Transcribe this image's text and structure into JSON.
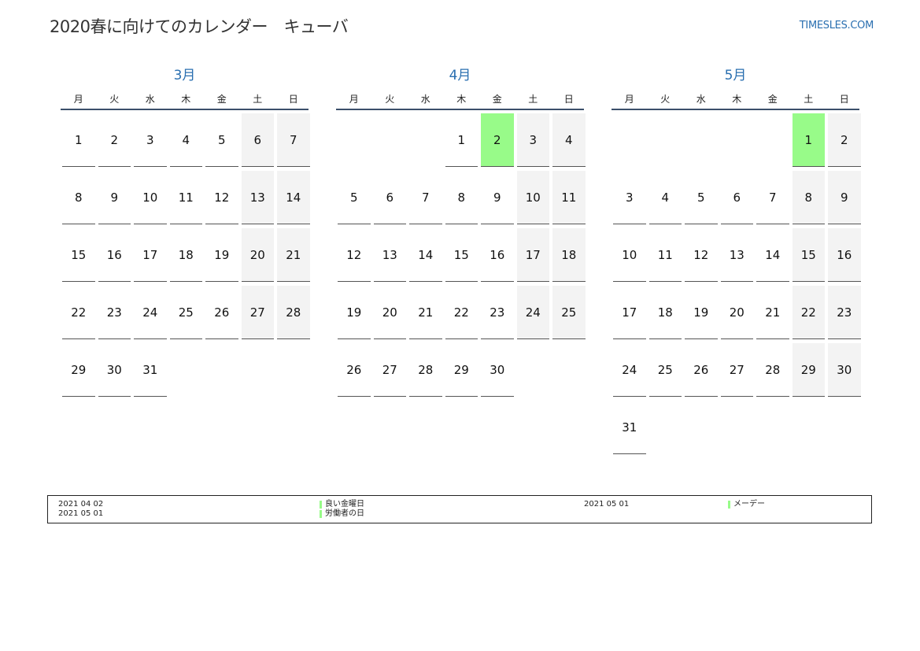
{
  "header": {
    "title": "2020春に向けてのカレンダー　キューバ",
    "site": "TIMESLES.COM"
  },
  "weekdays": [
    "月",
    "火",
    "水",
    "木",
    "金",
    "土",
    "日"
  ],
  "months": [
    {
      "name": "3月",
      "offset": 0,
      "days": 31,
      "holidays": []
    },
    {
      "name": "4月",
      "offset": 3,
      "days": 30,
      "holidays": [
        2
      ]
    },
    {
      "name": "5月",
      "offset": 5,
      "days": 31,
      "holidays": [
        1
      ]
    }
  ],
  "legend": {
    "rows": [
      {
        "date": "2021 04 02",
        "name": "良い金曜日"
      },
      {
        "date": "2021 05 01",
        "name": "労働者の日"
      }
    ],
    "right": {
      "date": "2021 05 01",
      "name": "メーデー"
    }
  },
  "colors": {
    "accent": "#2a6fb0",
    "holiday": "#98fb89",
    "weekend": "#f3f3f3"
  }
}
